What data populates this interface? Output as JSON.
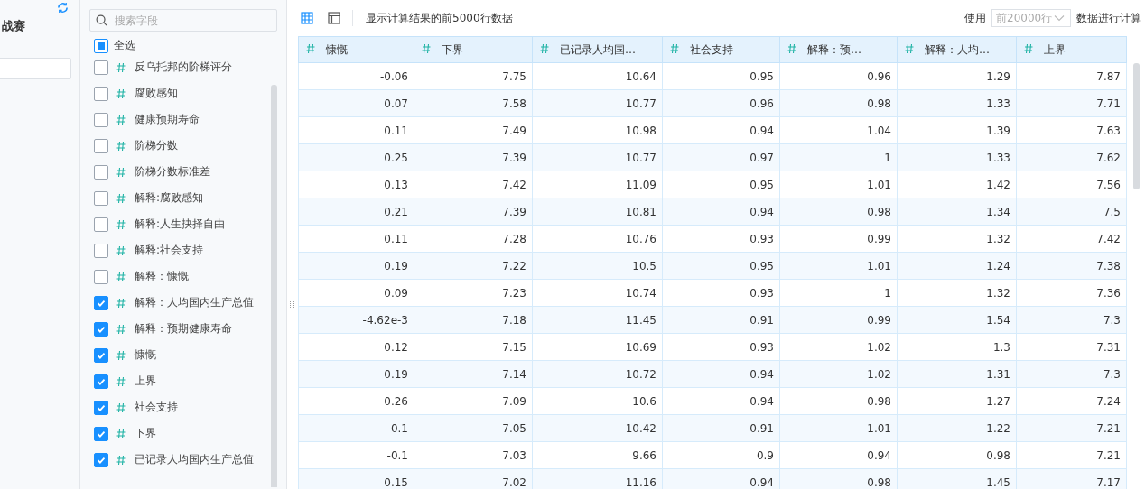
{
  "left_panel": {
    "title": "战赛"
  },
  "field_panel": {
    "search": {
      "placeholder": "搜索字段"
    },
    "select_all": {
      "label": "全选",
      "indeterminate": true
    },
    "fields": [
      {
        "label": "反乌托邦的阶梯评分",
        "checked": false
      },
      {
        "label": "腐败感知",
        "checked": false
      },
      {
        "label": "健康预期寿命",
        "checked": false
      },
      {
        "label": "阶梯分数",
        "checked": false
      },
      {
        "label": "阶梯分数标准差",
        "checked": false
      },
      {
        "label": "解释:腐败感知",
        "checked": false
      },
      {
        "label": "解释:人生抉择自由",
        "checked": false
      },
      {
        "label": "解释:社会支持",
        "checked": false
      },
      {
        "label": "解释：慷慨",
        "checked": false
      },
      {
        "label": "解释：人均国内生产总值",
        "checked": true
      },
      {
        "label": "解释：预期健康寿命",
        "checked": true
      },
      {
        "label": "慷慨",
        "checked": true
      },
      {
        "label": "上界",
        "checked": true
      },
      {
        "label": "社会支持",
        "checked": true
      },
      {
        "label": "下界",
        "checked": true
      },
      {
        "label": "已记录人均国内生产总值",
        "checked": true
      }
    ]
  },
  "toolbar": {
    "views": [
      {
        "kind": "grid",
        "selected": true
      },
      {
        "kind": "layout",
        "selected": false
      }
    ],
    "info": "显示计算结果的前5000行数据",
    "use_label": "使用",
    "rows_select": "前20000行",
    "suffix": "数据进行计算"
  },
  "table": {
    "columns": [
      "慷慨",
      "下界",
      "已记录人均国…",
      "社会支持",
      "解释：预…",
      "解释：人均…",
      "上界"
    ],
    "rows": [
      [
        "-0.06",
        "7.75",
        "10.64",
        "0.95",
        "0.96",
        "1.29",
        "7.87"
      ],
      [
        "0.07",
        "7.58",
        "10.77",
        "0.96",
        "0.98",
        "1.33",
        "7.71"
      ],
      [
        "0.11",
        "7.49",
        "10.98",
        "0.94",
        "1.04",
        "1.39",
        "7.63"
      ],
      [
        "0.25",
        "7.39",
        "10.77",
        "0.97",
        "1",
        "1.33",
        "7.62"
      ],
      [
        "0.13",
        "7.42",
        "11.09",
        "0.95",
        "1.01",
        "1.42",
        "7.56"
      ],
      [
        "0.21",
        "7.39",
        "10.81",
        "0.94",
        "0.98",
        "1.34",
        "7.5"
      ],
      [
        "0.11",
        "7.28",
        "10.76",
        "0.93",
        "0.99",
        "1.32",
        "7.42"
      ],
      [
        "0.19",
        "7.22",
        "10.5",
        "0.95",
        "1.01",
        "1.24",
        "7.38"
      ],
      [
        "0.09",
        "7.23",
        "10.74",
        "0.93",
        "1",
        "1.32",
        "7.36"
      ],
      [
        "-4.62e-3",
        "7.18",
        "11.45",
        "0.91",
        "0.99",
        "1.54",
        "7.3"
      ],
      [
        "0.12",
        "7.15",
        "10.69",
        "0.93",
        "1.02",
        "1.3",
        "7.31"
      ],
      [
        "0.19",
        "7.14",
        "10.72",
        "0.94",
        "1.02",
        "1.31",
        "7.3"
      ],
      [
        "0.26",
        "7.09",
        "10.6",
        "0.94",
        "0.98",
        "1.27",
        "7.24"
      ],
      [
        "0.1",
        "7.05",
        "10.42",
        "0.91",
        "1.01",
        "1.22",
        "7.21"
      ],
      [
        "-0.1",
        "7.03",
        "9.66",
        "0.9",
        "0.94",
        "0.98",
        "7.21"
      ],
      [
        "0.15",
        "7.02",
        "11.16",
        "0.94",
        "0.98",
        "1.45",
        "7.17"
      ]
    ]
  }
}
